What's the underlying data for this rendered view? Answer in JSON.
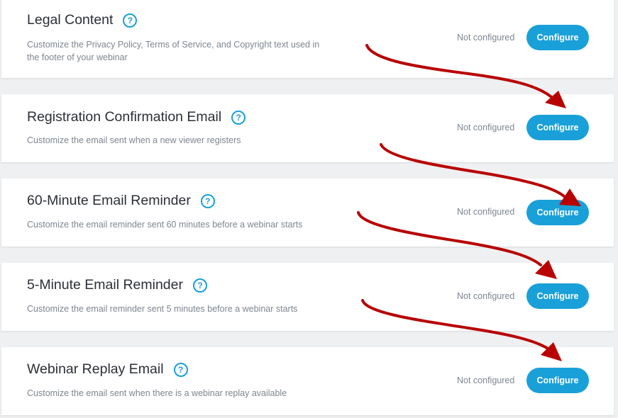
{
  "colors": {
    "accent": "#1aa0d8",
    "arrow": "#b80000",
    "card_bg": "#ffffff",
    "page_bg": "#eef0f2"
  },
  "icons": {
    "help": "question-circle-icon",
    "annotation": "red-curved-arrow"
  },
  "cards": [
    {
      "title": "Legal Content",
      "help_symbol": "?",
      "description_line1": "Customize the Privacy Policy, Terms of Service, and Copyright text used in",
      "description_line2": "the footer of your webinar",
      "status": "Not configured",
      "button_label": "Configure"
    },
    {
      "title": "Registration Confirmation Email",
      "help_symbol": "?",
      "description_line1": "Customize the email sent when a new viewer registers",
      "status": "Not configured",
      "button_label": "Configure"
    },
    {
      "title": "60-Minute Email Reminder",
      "help_symbol": "?",
      "description_line1": "Customize the email reminder sent 60 minutes before a webinar starts",
      "status": "Not configured",
      "button_label": "Configure"
    },
    {
      "title": "5-Minute Email Reminder",
      "help_symbol": "?",
      "description_line1": "Customize the email reminder sent 5 minutes before a webinar starts",
      "status": "Not configured",
      "button_label": "Configure"
    },
    {
      "title": "Webinar Replay Email",
      "help_symbol": "?",
      "description_line1": "Customize the email sent when there is a webinar replay available",
      "status": "Not configured",
      "button_label": "Configure"
    }
  ]
}
